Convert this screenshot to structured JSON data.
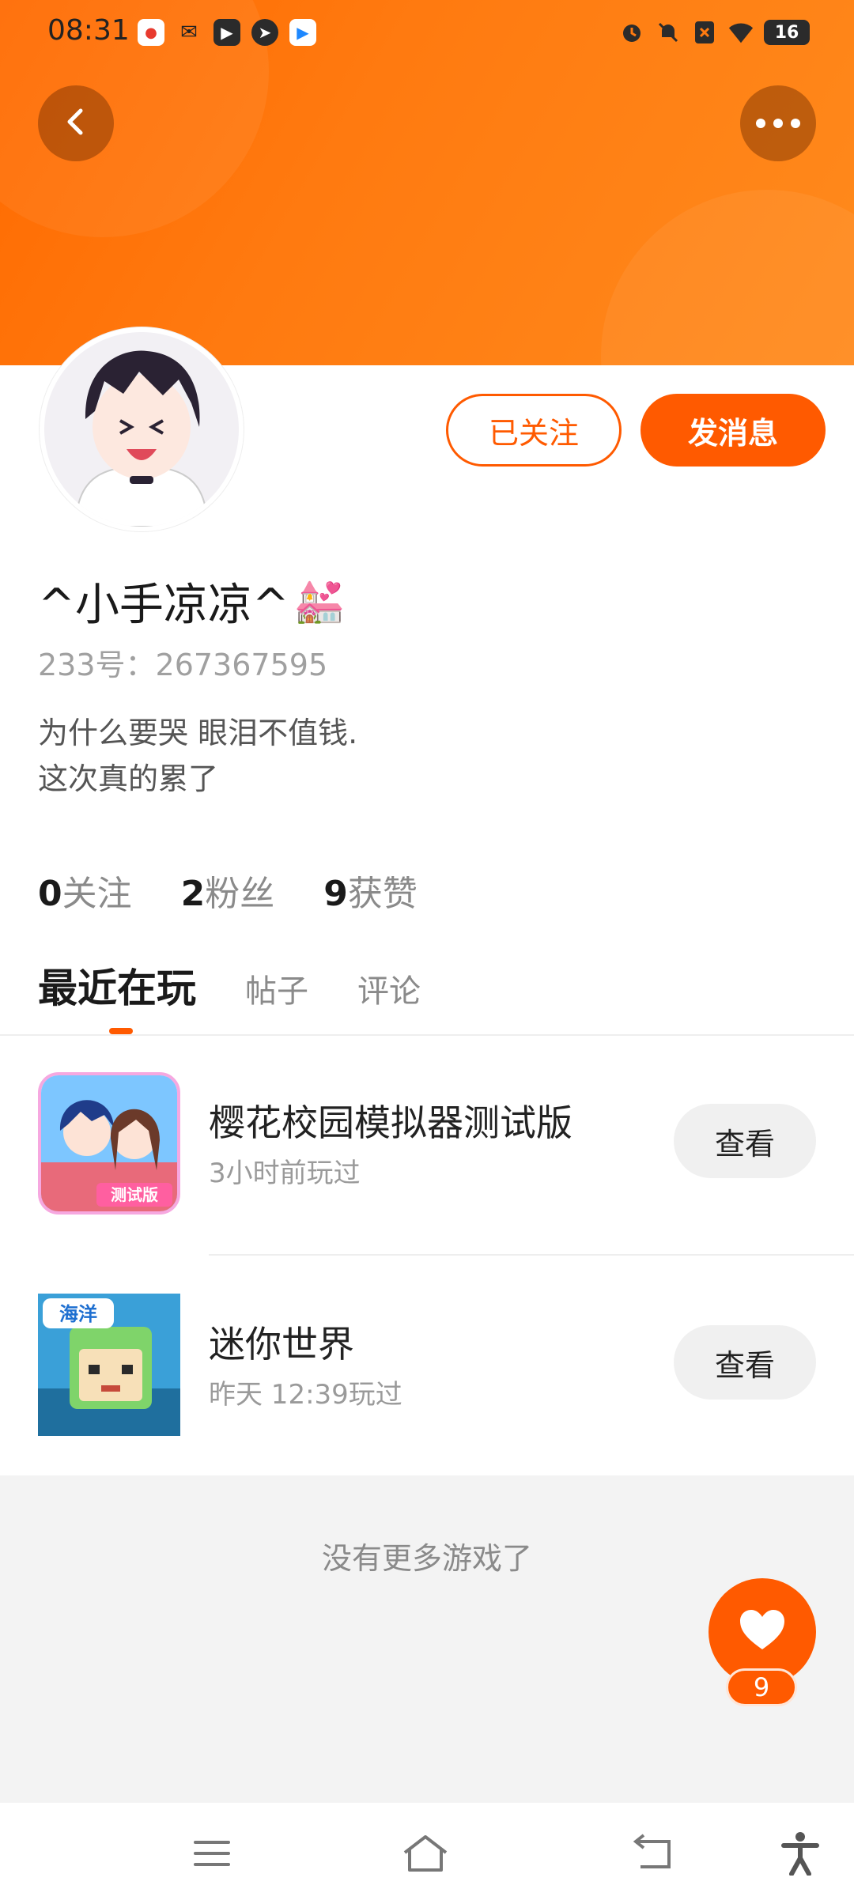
{
  "status_bar": {
    "time": "08:31",
    "battery": "16",
    "left_icons": [
      "toutiao-app-icon",
      "wechat-icon",
      "video-app-icon",
      "compass-app-icon",
      "play-app-icon"
    ],
    "right_icons": [
      "alarm-icon",
      "mute-icon",
      "sim-off-icon",
      "wifi-icon"
    ]
  },
  "header": {
    "back_icon": "chevron-left-icon",
    "more_icon": "more-dots-icon",
    "accent_color": "#ff5a00"
  },
  "profile": {
    "username": "^小手凉凉^",
    "username_emoji": "💒",
    "id_text": "233号：267367595",
    "bio_line1": "为什么要哭 眼泪不值钱.",
    "bio_line2": "这次真的累了",
    "follow_button": "已关注",
    "message_button": "发消息"
  },
  "stats": {
    "following_num": "0",
    "following_label": "关注",
    "fans_num": "2",
    "fans_label": "粉丝",
    "likes_num": "9",
    "likes_label": "获赞"
  },
  "tabs": {
    "recent": "最近在玩",
    "posts": "帖子",
    "comments": "评论"
  },
  "games": [
    {
      "title": "樱花校园模拟器测试版",
      "subtitle": "3小时前玩过",
      "action": "查看",
      "badge": "测试版"
    },
    {
      "title": "迷你世界",
      "subtitle": "昨天 12:39玩过",
      "action": "查看",
      "badge": "海洋"
    }
  ],
  "footer": {
    "no_more": "没有更多游戏了",
    "like_count": "9"
  },
  "nav": [
    "menu-icon",
    "home-icon",
    "back-icon",
    "accessibility-icon"
  ]
}
